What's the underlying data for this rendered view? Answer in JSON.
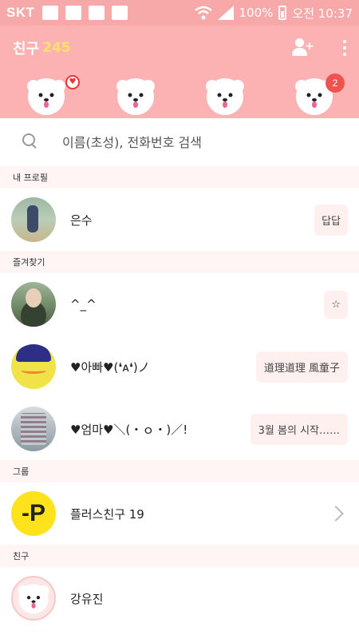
{
  "status_bar": {
    "carrier": "SKT",
    "battery": "100%",
    "time": "오전 10:37",
    "icons": [
      "facebook-icon",
      "gallery-icon",
      "mail-icon",
      "castle-icon",
      "wifi-icon",
      "signal-icon",
      "battery-icon"
    ]
  },
  "header": {
    "title": "친구",
    "count": "245",
    "icons": [
      "add-friend-icon",
      "more-menu-icon"
    ],
    "notification_badge": "2",
    "heart_icon": "♥"
  },
  "search": {
    "placeholder": "이름(초성), 전화번호 검색"
  },
  "sections": {
    "my_profile": "내 프로필",
    "favorites": "즐겨찾기",
    "groups": "그룹",
    "friends": "친구"
  },
  "my_profile": {
    "name": "은수",
    "status": "답답"
  },
  "favorites": [
    {
      "name": "^_^",
      "status": "☆"
    },
    {
      "name": "♥아빠♥(❛ᴀ❛)ノ",
      "status": "道理道理 風童子"
    },
    {
      "name": "♥엄마♥＼(・ｏ・)／!",
      "status": "3월 봄의 시작……"
    }
  ],
  "group": {
    "name": "플러스친구 19",
    "logo": "-P"
  },
  "friends": [
    {
      "name": "강유진"
    }
  ],
  "colors": {
    "status_bar": "#f7a8a8",
    "header": "#fcb2b2",
    "count": "#fde26a",
    "badge": "#ef5350",
    "section_bg": "#fff5f5",
    "bubble_bg": "#fff0f0",
    "plus_friend": "#fde21c"
  }
}
